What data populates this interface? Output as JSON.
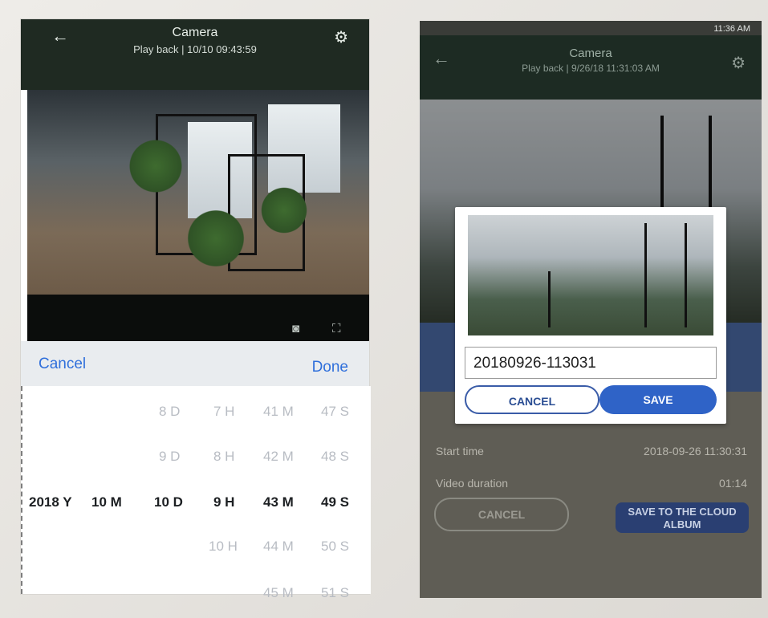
{
  "left_screen": {
    "title": "Camera",
    "subtitle": "Play back | 10/10 09:43:59",
    "picker": {
      "cancel_label": "Cancel",
      "done_label": "Done",
      "rows": [
        {
          "cells": [
            "",
            "",
            "8 D",
            "7 H",
            "41 M",
            "47 S"
          ]
        },
        {
          "cells": [
            "",
            "",
            "9 D",
            "8 H",
            "42 M",
            "48 S"
          ]
        },
        {
          "cells": [
            "2018 Y",
            "10 M",
            "10 D",
            "9 H",
            "43 M",
            "49 S"
          ]
        },
        {
          "cells": [
            "",
            "",
            "",
            "10 H",
            "44 M",
            "50 S"
          ]
        },
        {
          "cells": [
            "",
            "",
            "",
            "",
            "45 M",
            "51 S"
          ]
        }
      ]
    }
  },
  "right_screen": {
    "status_time": "11:36 AM",
    "title": "Camera",
    "subtitle": "Play back | 9/26/18 11:31:03 AM",
    "save_dialog": {
      "filename": "20180926-113031",
      "cancel_label": "CANCEL",
      "save_label": "SAVE"
    },
    "info": {
      "start_time_label": "Start time",
      "start_time_value": "2018-09-26 11:30:31",
      "duration_label": "Video duration",
      "duration_value": "01:14"
    },
    "bottom": {
      "cancel_label": "CANCEL",
      "save_cloud_label": "SAVE TO THE CLOUD ALBUM"
    }
  },
  "icons": {
    "back": "arrow-left",
    "settings": "gear",
    "snapshot": "camera",
    "fullscreen": "expand"
  },
  "colors": {
    "topbar": "#1f2a22",
    "accent_blue": "#2f63c7",
    "picker_link": "#2f6fdb"
  }
}
